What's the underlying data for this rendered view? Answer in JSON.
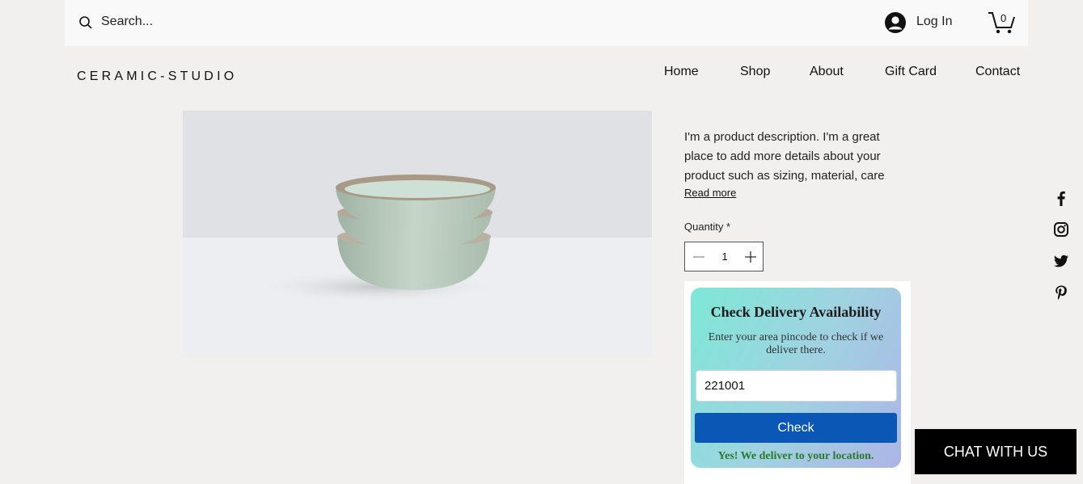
{
  "header": {
    "search_placeholder": "Search...",
    "login_label": "Log In",
    "cart_count": "0"
  },
  "brand": "CERAMIC-STUDIO",
  "nav": [
    {
      "label": "Home"
    },
    {
      "label": "Shop"
    },
    {
      "label": "About"
    },
    {
      "label": "Gift Card"
    },
    {
      "label": "Contact"
    }
  ],
  "product": {
    "description": "I'm a product description. I'm a great place to add more details about your product such as sizing, material, care",
    "read_more": "Read more",
    "quantity_label": "Quantity *",
    "quantity": "1"
  },
  "delivery": {
    "title": "Check Delivery Availability",
    "subtitle": "Enter your area pincode to check if we deliver there.",
    "pincode": "221001",
    "button": "Check",
    "result": "Yes! We deliver to your location."
  },
  "social": [
    "facebook-icon",
    "instagram-icon",
    "twitter-icon",
    "pinterest-icon"
  ],
  "chat": {
    "label": "CHAT WITH US"
  }
}
